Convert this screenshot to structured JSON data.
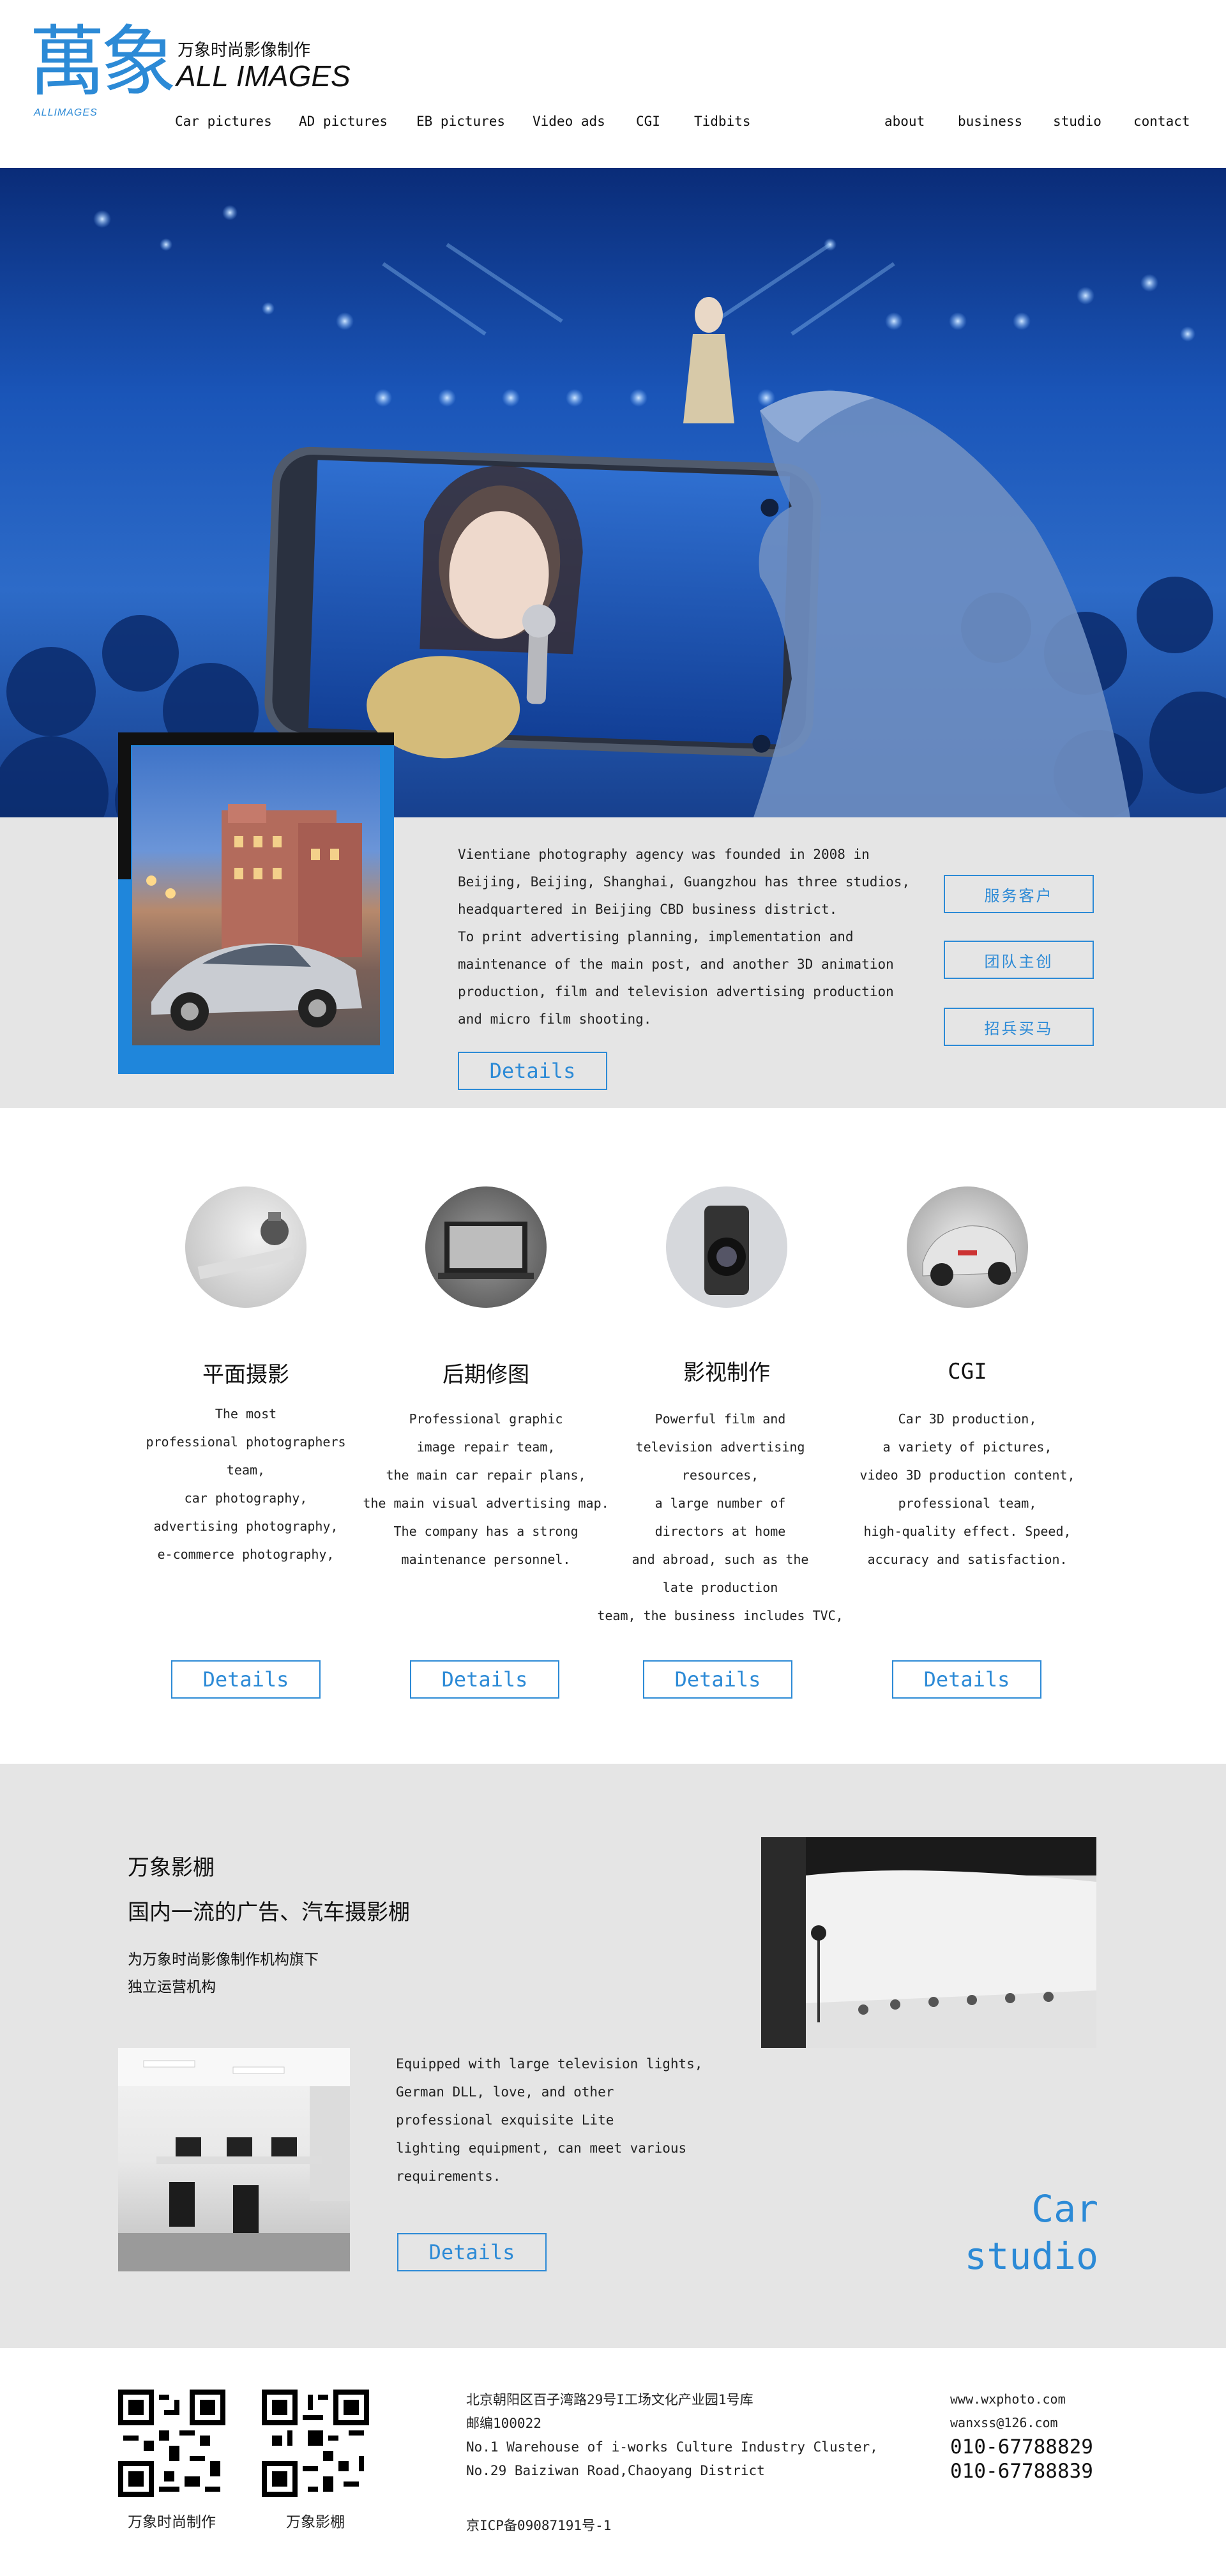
{
  "header": {
    "logo_cn": "萬象",
    "logo_sub": "ALLIMAGES",
    "tagline_cn": "万象时尚影像制作",
    "brand": "ALL IMAGES",
    "nav_left": [
      "Car pictures",
      "AD pictures",
      "EB pictures",
      "Video ads",
      "CGI",
      "Tidbits"
    ],
    "nav_right": [
      "about",
      "business",
      "studio",
      "contact"
    ]
  },
  "intro": {
    "paragraph": [
      "Vientiane photography agency was founded in 2008 in",
      "Beijing, Beijing, Shanghai, Guangzhou has three studios,",
      "headquartered in Beijing CBD business district.",
      "To print advertising planning, implementation and",
      "maintenance of the main post, and another 3D animation",
      "production, film and television advertising production",
      "and micro film shooting."
    ],
    "details_label": "Details",
    "side_buttons": [
      "服务客户",
      "团队主创",
      "招兵买马"
    ]
  },
  "services": [
    {
      "title": "平面摄影",
      "desc": [
        "The most",
        "professional photographers",
        "team,",
        "car photography,",
        "advertising photography,",
        "e-commerce photography,"
      ],
      "details_label": "Details"
    },
    {
      "title": "后期修图",
      "desc": [
        "Professional graphic",
        "image repair team,",
        "the main car repair plans,",
        "the main visual advertising map.",
        "The company has a strong",
        "maintenance personnel."
      ],
      "details_label": "Details"
    },
    {
      "title": "影视制作",
      "desc": [
        "Powerful film and",
        "television advertising",
        "resources,",
        "a large number of",
        "directors at home",
        "and abroad, such as the",
        "late production",
        "team, the business includes TVC,"
      ],
      "details_label": "Details"
    },
    {
      "title": "CGI",
      "desc": [
        "Car 3D production,",
        "a variety of pictures,",
        "video 3D production content,",
        "professional team,",
        "high-quality effect. Speed,",
        "accuracy and satisfaction."
      ],
      "details_label": "Details"
    }
  ],
  "studio": {
    "title1": "万象影棚",
    "title2": "国内一流的广告、汽车摄影棚",
    "sub1": "为万象时尚影像制作机构旗下",
    "sub2": "独立运营机构",
    "paragraph": [
      "Equipped with large television lights,",
      "German DLL, love, and other",
      "professional exquisite Lite",
      "lighting equipment, can meet various",
      "requirements."
    ],
    "details_label": "Details",
    "side_title": [
      "Car",
      "studio"
    ]
  },
  "footer": {
    "qr_labels": [
      "万象时尚制作",
      "万象影棚"
    ],
    "address": [
      "北京朝阳区百子湾路29号I工场文化产业园1号库",
      "邮编100022",
      "No.1 Warehouse of i-works Culture Industry Cluster,",
      "No.29 Baiziwan Road,Chaoyang District"
    ],
    "icp": "京ICP备09087191号-1",
    "website": "www.wxphoto.com",
    "email": "wanxss@126.com",
    "phones": [
      "010-67788829",
      "010-67788839"
    ]
  },
  "colors": {
    "accent": "#2c8ad6",
    "band": "#e5e5e5"
  }
}
